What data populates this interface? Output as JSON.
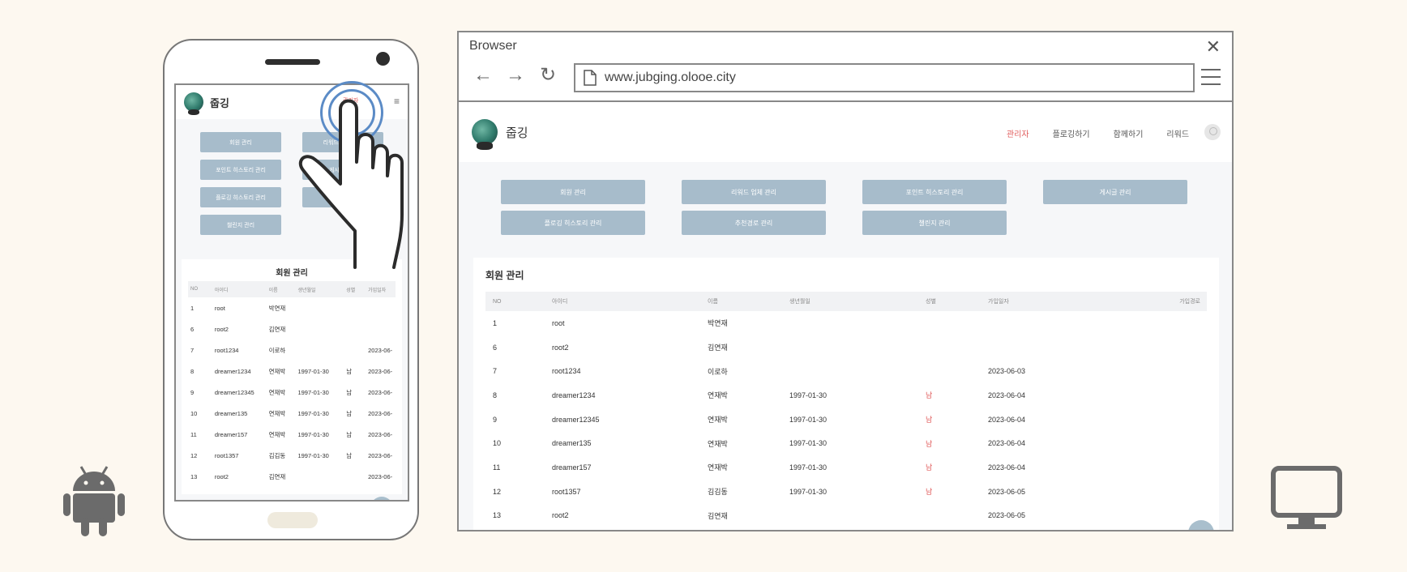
{
  "mobile": {
    "brand": "줍깅",
    "admin_label": "관리자",
    "menu_icon": "≡",
    "buttons": [
      "회원 관리",
      "리워드 업체 관리",
      "포인트 히스토리 관리",
      "게시글 관리",
      "플로깅 히스토리 관리",
      "추천경로 관리",
      "챌린지 관리"
    ],
    "card_title": "회원 관리",
    "table_headers": [
      "NO",
      "아이디",
      "이름",
      "생년월일",
      "성별",
      "가입일자"
    ],
    "rows": [
      [
        "1",
        "root",
        "박연재",
        "",
        "",
        ""
      ],
      [
        "6",
        "root2",
        "김연재",
        "",
        "",
        ""
      ],
      [
        "7",
        "root1234",
        "이로하",
        "",
        "",
        "2023-06-"
      ],
      [
        "8",
        "dreamer1234",
        "연재박",
        "1997-01-30",
        "남",
        "2023-06-"
      ],
      [
        "9",
        "dreamer12345",
        "연재박",
        "1997-01-30",
        "남",
        "2023-06-"
      ],
      [
        "10",
        "dreamer135",
        "연재박",
        "1997-01-30",
        "남",
        "2023-06-"
      ],
      [
        "11",
        "dreamer157",
        "연재박",
        "1997-01-30",
        "남",
        "2023-06-"
      ],
      [
        "12",
        "root1357",
        "김김동",
        "1997-01-30",
        "남",
        "2023-06-"
      ],
      [
        "13",
        "root2",
        "김연재",
        "",
        "",
        "2023-06-"
      ]
    ],
    "top_button": "↑"
  },
  "browser": {
    "window_title": "Browser",
    "close_icon": "✕",
    "nav_icons": [
      "←",
      "→",
      "↻"
    ],
    "url": "www.jubging.olooe.city",
    "brand": "줍깅",
    "nav_links": [
      "관리자",
      "플로깅하기",
      "함께하기",
      "리워드"
    ],
    "buttons": [
      "회원 관리",
      "리워드 업체 관리",
      "포인트 히스토리 관리",
      "게시글 관리",
      "플로깅 히스토리 관리",
      "추천경로 관리",
      "챌린지 관리"
    ],
    "card_title": "회원 관리",
    "table_headers": [
      "NO",
      "아이디",
      "이름",
      "생년월일",
      "성별",
      "가입일자",
      "가입경로"
    ],
    "rows": [
      [
        "1",
        "root",
        "박연재",
        "",
        "",
        "",
        ""
      ],
      [
        "6",
        "root2",
        "김연재",
        "",
        "",
        "",
        ""
      ],
      [
        "7",
        "root1234",
        "이로하",
        "",
        "",
        "2023-06-03",
        ""
      ],
      [
        "8",
        "dreamer1234",
        "연재박",
        "1997-01-30",
        "남",
        "2023-06-04",
        ""
      ],
      [
        "9",
        "dreamer12345",
        "연재박",
        "1997-01-30",
        "남",
        "2023-06-04",
        ""
      ],
      [
        "10",
        "dreamer135",
        "연재박",
        "1997-01-30",
        "남",
        "2023-06-04",
        ""
      ],
      [
        "11",
        "dreamer157",
        "연재박",
        "1997-01-30",
        "남",
        "2023-06-04",
        ""
      ],
      [
        "12",
        "root1357",
        "김김동",
        "1997-01-30",
        "남",
        "2023-06-05",
        ""
      ],
      [
        "13",
        "root2",
        "김연재",
        "",
        "",
        "2023-06-05",
        ""
      ]
    ],
    "top_button": "↑"
  },
  "colors": {
    "background": "#fdf8f0",
    "button": "#a7bccb",
    "accent": "#e05a5a",
    "tap_ring": "#5b8bc6"
  },
  "icons": {
    "platform_left": "android-icon",
    "platform_right": "monitor-icon",
    "gesture": "tap-hand-icon"
  }
}
